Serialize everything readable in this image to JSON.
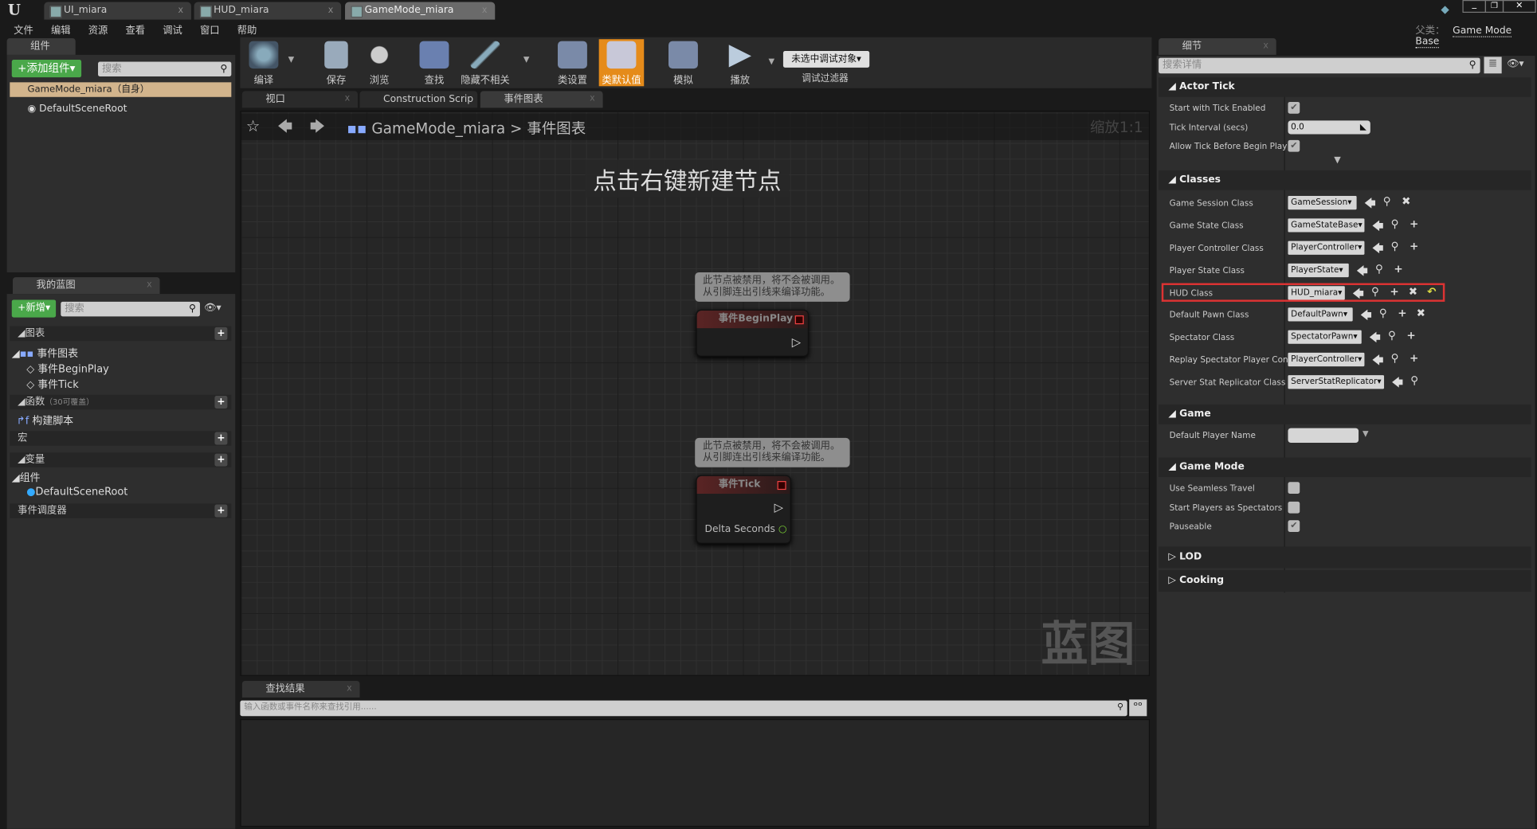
{
  "window": {
    "tabs": [
      {
        "label": "UI_miara"
      },
      {
        "label": "HUD_miara"
      },
      {
        "label": "GameMode_miara"
      }
    ],
    "parent_class_label": "父类：",
    "parent_class": "Game Mode Base"
  },
  "menu": [
    "文件",
    "编辑",
    "资源",
    "查看",
    "调试",
    "窗口",
    "帮助"
  ],
  "components": {
    "tab": "组件",
    "add_button": "+添加组件▾",
    "search_placeholder": "搜索",
    "root_item": "GameMode_miara（自身）",
    "child": "DefaultSceneRoot"
  },
  "toolbar": {
    "compile": "编译",
    "save": "保存",
    "browse": "浏览",
    "find": "查找",
    "hide_unrelated": "隐藏不相关",
    "class_settings": "类设置",
    "class_defaults": "类默认值",
    "simulate": "模拟",
    "play": "播放",
    "debug_object": "未选中调试对象▾",
    "debug_filter": "调试过滤器"
  },
  "graph_tabs": [
    {
      "label": "视口"
    },
    {
      "label": "Construction Scrip"
    },
    {
      "label": "事件图表"
    }
  ],
  "breadcrumb": {
    "root": "GameMode_miara",
    "sep": ">",
    "current": "事件图表",
    "zoom": "缩放1:1"
  },
  "graph": {
    "hint": "点击右键新建节点",
    "watermark": "蓝图",
    "comment": "此节点被禁用，将不会被调用。\n从引脚连出引线来编译功能。",
    "nodes": [
      {
        "title": "事件BeginPlay"
      },
      {
        "title": "事件Tick",
        "pin": "Delta Seconds"
      }
    ]
  },
  "my_blueprint": {
    "tab": "我的蓝图",
    "new_button": "+新增▾",
    "search_placeholder": "搜索",
    "graphs": "图表",
    "event_graph": "事件图表",
    "events": [
      "事件BeginPlay",
      "事件Tick"
    ],
    "functions": "函数",
    "functions_note": "（30可覆盖）",
    "construction": "构建脚本",
    "macros": "宏",
    "variables": "变量",
    "components": "组件",
    "component_item": "DefaultSceneRoot",
    "dispatchers": "事件调度器"
  },
  "find_results": {
    "tab": "查找结果",
    "placeholder": "输入函数或事件名称来查找引用......"
  },
  "details": {
    "tab": "细节",
    "search_placeholder": "搜索详情",
    "actor_tick": {
      "title": "Actor Tick",
      "start_with_tick": {
        "label": "Start with Tick Enabled",
        "checked": true
      },
      "tick_interval": {
        "label": "Tick Interval (secs)",
        "value": "0.0"
      },
      "allow_before_play": {
        "label": "Allow Tick Before Begin Play",
        "checked": true
      }
    },
    "classes": {
      "title": "Classes",
      "rows": [
        {
          "label": "Game Session Class",
          "value": "GameSession"
        },
        {
          "label": "Game State Class",
          "value": "GameStateBase"
        },
        {
          "label": "Player Controller Class",
          "value": "PlayerController"
        },
        {
          "label": "Player State Class",
          "value": "PlayerState"
        },
        {
          "label": "HUD Class",
          "value": "HUD_miara"
        },
        {
          "label": "Default Pawn Class",
          "value": "DefaultPawn"
        },
        {
          "label": "Spectator Class",
          "value": "SpectatorPawn"
        },
        {
          "label": "Replay Spectator Player Con",
          "value": "PlayerController"
        },
        {
          "label": "Server Stat Replicator Class",
          "value": "ServerStatReplicator"
        }
      ]
    },
    "game": {
      "title": "Game",
      "default_player_name": {
        "label": "Default Player Name",
        "value": ""
      }
    },
    "game_mode": {
      "title": "Game Mode",
      "rows": [
        {
          "label": "Use Seamless Travel",
          "checked": false
        },
        {
          "label": "Start Players as Spectators",
          "checked": false
        },
        {
          "label": "Pauseable",
          "checked": true
        }
      ]
    },
    "lod": "LOD",
    "cooking": "Cooking"
  },
  "colors": {
    "accent": "#e58b1a",
    "green": "#4aa84a",
    "highlight": "#e03030"
  }
}
